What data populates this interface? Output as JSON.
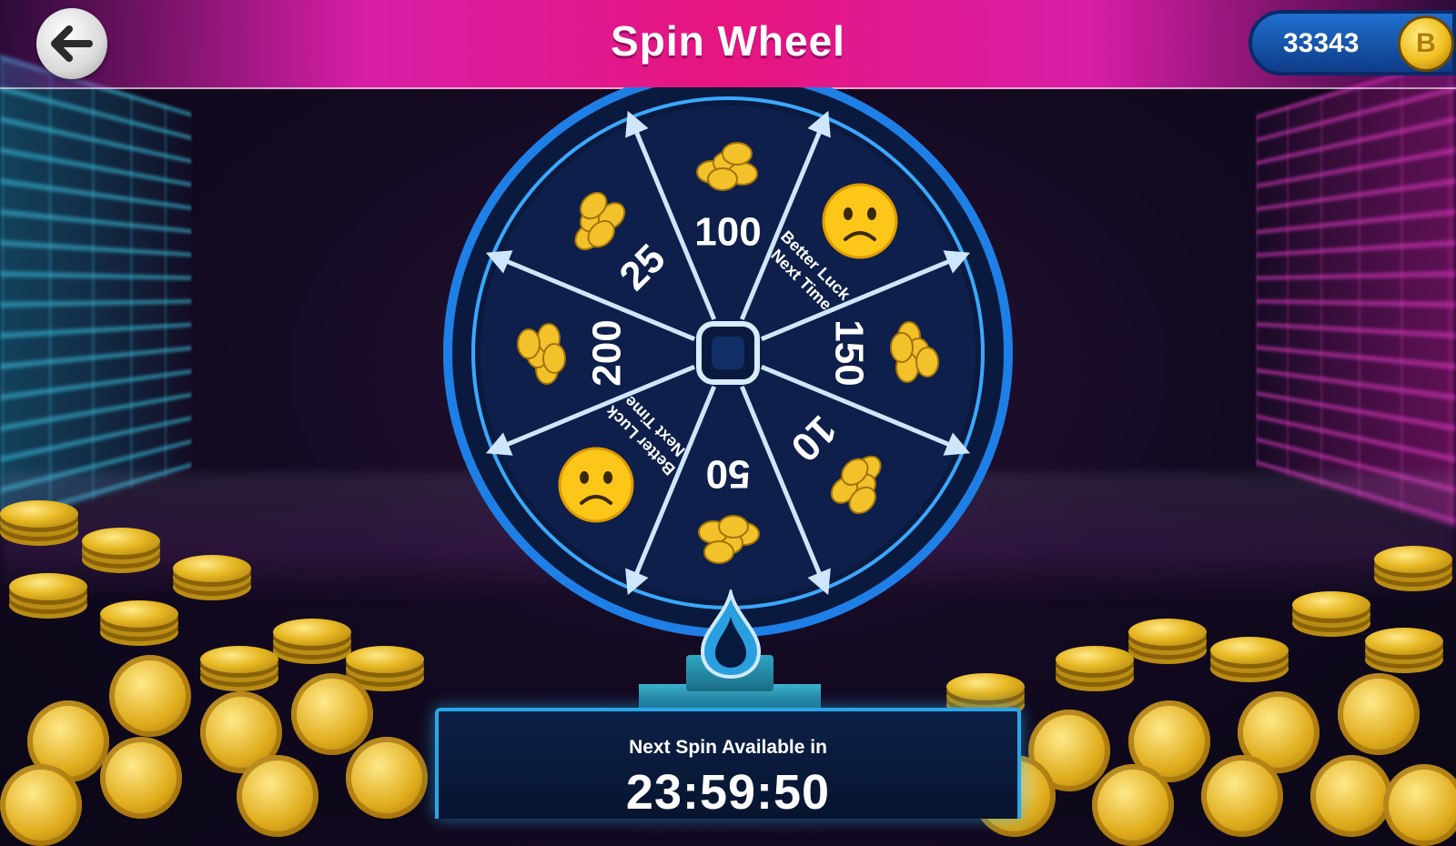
{
  "header": {
    "title": "Spin Wheel",
    "back_icon": "arrow-left-icon"
  },
  "wallet": {
    "coins": "33343",
    "coin_icon_letter": "B"
  },
  "wheel": {
    "segments": [
      {
        "label": "100",
        "kind": "coins",
        "icon": "coins-icon"
      },
      {
        "label": "Better Luck Next Time",
        "kind": "miss",
        "icon": "sad-face-icon"
      },
      {
        "label": "150",
        "kind": "coins",
        "icon": "coins-icon"
      },
      {
        "label": "10",
        "kind": "coins",
        "icon": "coins-icon"
      },
      {
        "label": "50",
        "kind": "coins",
        "icon": "coins-icon"
      },
      {
        "label": "Better Luck Next Time",
        "kind": "miss",
        "icon": "sad-face-icon"
      },
      {
        "label": "200",
        "kind": "coins",
        "icon": "coins-icon"
      },
      {
        "label": "25",
        "kind": "coins",
        "icon": "coins-icon"
      }
    ],
    "colors": {
      "rim": "#1e7fe6",
      "segment": "#0d1f4a",
      "divider": "#cfe6ff"
    }
  },
  "timer": {
    "label": "Next Spin Available in",
    "value": "23:59:50"
  }
}
